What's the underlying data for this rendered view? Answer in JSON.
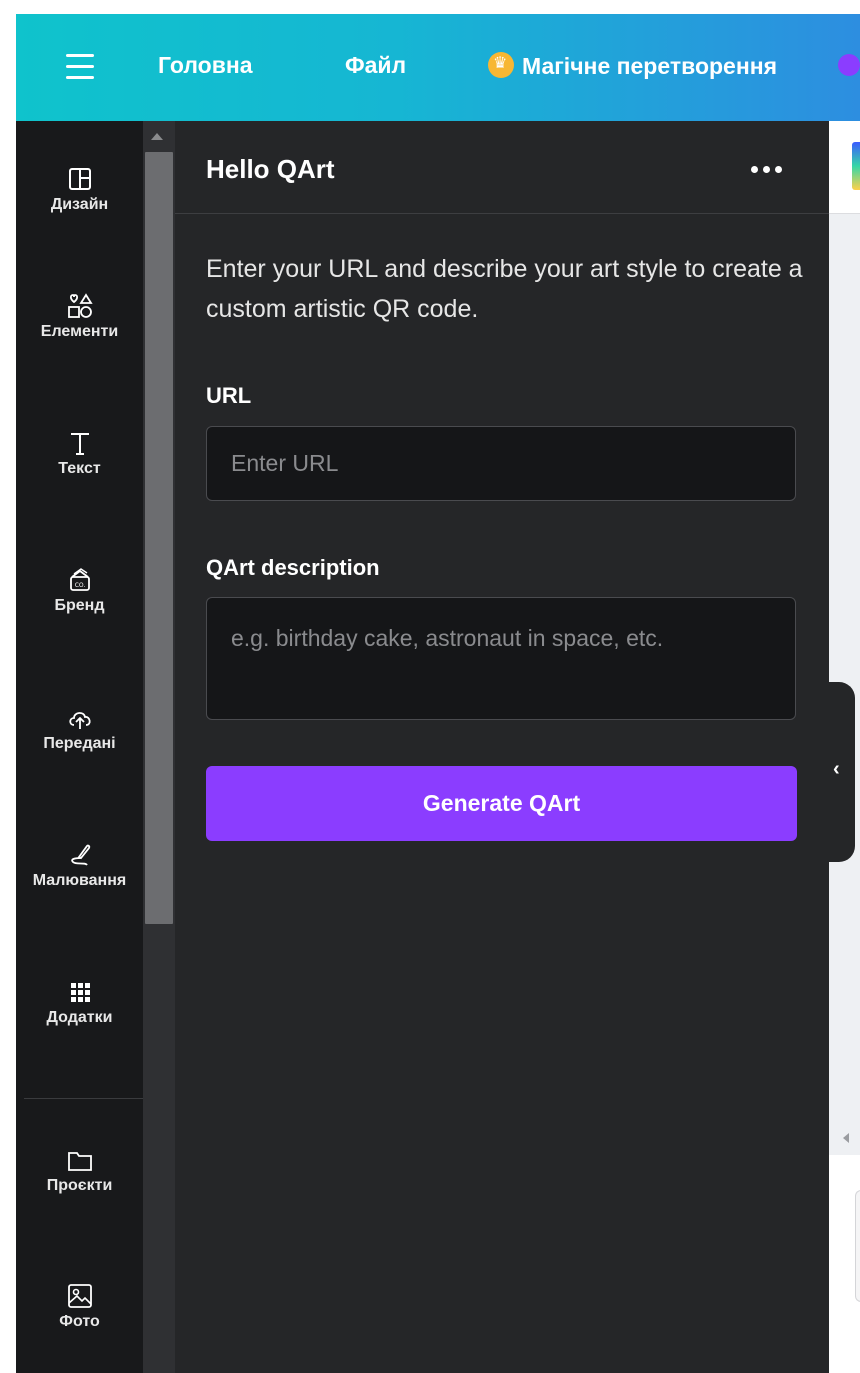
{
  "topbar": {
    "nav": [
      {
        "label": "Головна"
      },
      {
        "label": "Файл"
      },
      {
        "label": "Магічне перетворення"
      }
    ]
  },
  "rail": {
    "items": [
      {
        "label": "Дизайн",
        "icon": "layout-icon"
      },
      {
        "label": "Елементи",
        "icon": "shapes-icon"
      },
      {
        "label": "Текст",
        "icon": "text-icon"
      },
      {
        "label": "Бренд",
        "icon": "brand-kit-icon"
      },
      {
        "label": "Передані",
        "icon": "cloud-upload-icon"
      },
      {
        "label": "Малювання",
        "icon": "draw-icon"
      },
      {
        "label": "Додатки",
        "icon": "apps-grid-icon"
      },
      {
        "label": "Проєкти",
        "icon": "folder-icon"
      },
      {
        "label": "Фото",
        "icon": "photo-icon"
      }
    ]
  },
  "panel": {
    "title": "Hello QArt",
    "intro": "Enter your URL and describe your art style to create a custom artistic QR code.",
    "url_label": "URL",
    "url_placeholder": "Enter URL",
    "url_value": "",
    "desc_label": "QArt description",
    "desc_placeholder": "e.g. birthday cake, astronaut in space, etc.",
    "desc_value": "",
    "generate_label": "Generate QArt"
  },
  "colors": {
    "accent": "#8b3dff",
    "panel_bg": "#252628",
    "rail_bg": "#18191b",
    "topbar_start": "#0fc3cc",
    "topbar_end": "#2d8ee0"
  }
}
